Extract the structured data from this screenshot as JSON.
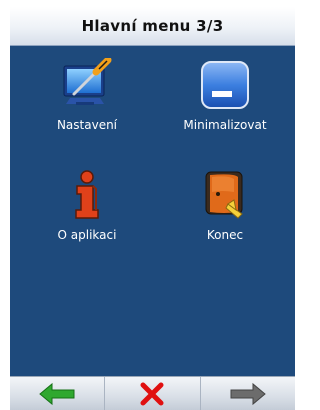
{
  "header": {
    "title": "Hlavní menu 3/3"
  },
  "menu": {
    "items": [
      {
        "label": "Nastavení",
        "icon": "settings-screwdriver-icon"
      },
      {
        "label": "Minimalizovat",
        "icon": "minimize-window-icon"
      },
      {
        "label": "O aplikaci",
        "icon": "info-icon"
      },
      {
        "label": "Konec",
        "icon": "exit-door-icon"
      }
    ]
  },
  "navigation": {
    "back": {
      "icon": "arrow-left-icon",
      "color": "#2fa82f"
    },
    "cancel": {
      "icon": "close-icon",
      "color": "#e01010"
    },
    "forward": {
      "icon": "arrow-right-icon",
      "color": "#6c6c6c"
    }
  },
  "colors": {
    "panel_background": "#1e4a7c",
    "title_bar": "#eef2f7"
  }
}
